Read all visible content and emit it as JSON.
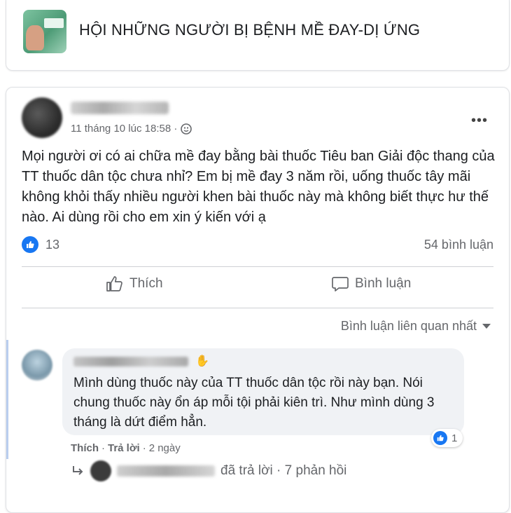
{
  "group": {
    "title": "HỘI NHỮNG NGƯỜI BỊ BỆNH MỀ ĐAY-DỊ ỨNG"
  },
  "post": {
    "timestamp": "11 tháng 10 lúc 18:58 ·",
    "privacy_icon": "public-globe-icon",
    "more_icon": "more-options-icon",
    "text": "Mọi người ơi có ai chữa mề đay bằng bài thuốc Tiêu ban Giải độc thang của TT thuốc dân tộc chưa nhỉ? Em bị mề đay 3 năm rồi, uống thuốc tây mãi không khỏi thấy nhiều người khen bài thuốc này mà không biết thực hư thế nào. Ai dùng rồi cho em xin ý kiến với ạ",
    "like_count": "13",
    "comment_count": "54 bình luận",
    "actions": {
      "like_label": "Thích",
      "comment_label": "Bình luận"
    },
    "sort_label": "Bình luận liên quan nhất"
  },
  "comment": {
    "text": "Mình dùng thuốc này của TT thuốc dân tộc rồi này bạn. Nói chung thuốc này ổn áp mỗi tội phải kiên trì. Như mình dùng 3 tháng là dứt điểm hẳn.",
    "reaction_count": "1",
    "like_label": "Thích",
    "reply_label": "Trả lời",
    "age": "2 ngày",
    "reply_summary": "đã trả lời · 7 phản hồi"
  },
  "colors": {
    "accent": "#1877f2",
    "muted_text": "#65676b",
    "bubble": "#f0f2f5"
  }
}
